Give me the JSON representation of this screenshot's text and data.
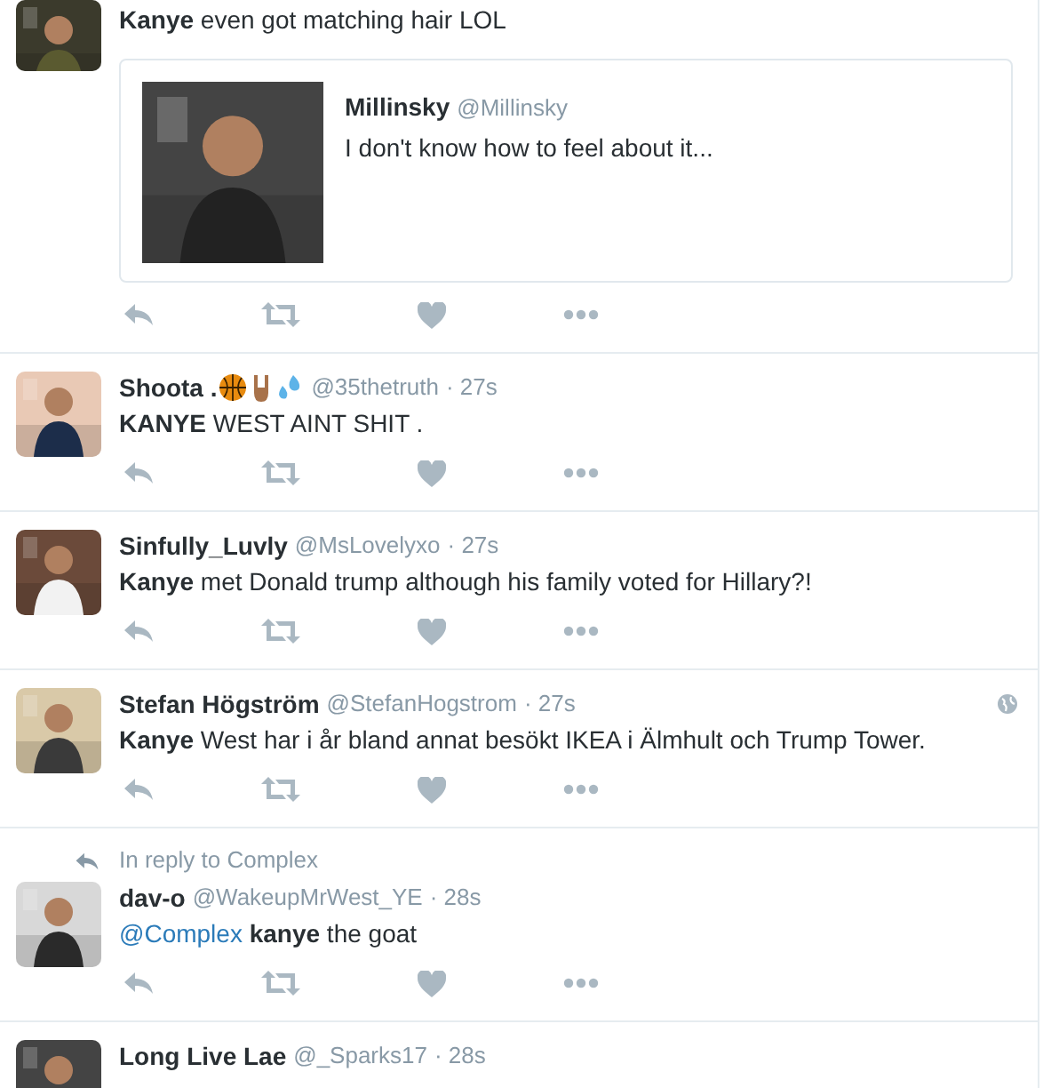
{
  "tweets": [
    {
      "avatar_cut": true,
      "text": "**Kanye** even got matching hair LOL",
      "quote": {
        "name": "Millinsky",
        "handle": "@Millinsky",
        "text": "I don't know how to feel about it..."
      }
    },
    {
      "name": "Shoota .",
      "has_emoji": true,
      "handle": "@35thetruth",
      "time": "· 27s",
      "text": "**KANYE** WEST AINT SHIT ."
    },
    {
      "name": "Sinfully_Luvly",
      "handle": "@MsLovelyxo",
      "time": "· 27s",
      "text": "**Kanye** met Donald trump although his family voted for Hillary?!"
    },
    {
      "name": "Stefan Högström",
      "handle": "@StefanHogstrom",
      "time": "· 27s",
      "geo": true,
      "text": "**Kanye** West har i år bland annat besökt IKEA i Älmhult och Trump Tower."
    },
    {
      "reply_to": "In reply to Complex",
      "name": "dav-o",
      "handle": "@WakeupMrWest_YE",
      "time": "· 28s",
      "mention": "@Complex",
      "text": "**kanye** the goat"
    },
    {
      "name": "Long Live Lae",
      "handle": "@_Sparks17",
      "time": "· 28s"
    }
  ]
}
